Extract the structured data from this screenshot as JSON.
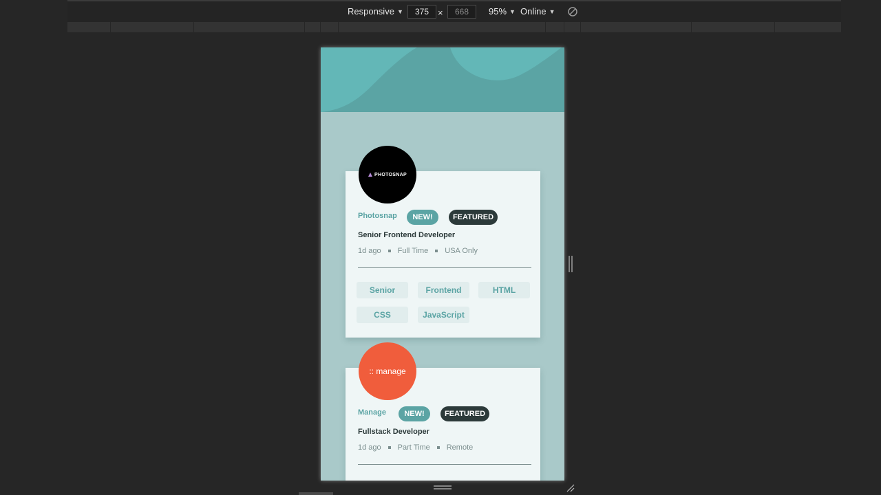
{
  "devtools": {
    "device_mode": "Responsive",
    "width_value": "375",
    "height_placeholder": "668",
    "zoom": "95%",
    "throttling": "Online",
    "times_symbol": "×"
  },
  "jobs": [
    {
      "company": "Photosnap",
      "logo_text": "PHOTOSNAP",
      "logo_color": "#000000",
      "new_label": "NEW!",
      "featured_label": "FEATURED",
      "position": "Senior Frontend Developer",
      "posted": "1d ago",
      "contract": "Full Time",
      "location": "USA Only",
      "tags": [
        "Senior",
        "Frontend",
        "HTML",
        "CSS",
        "JavaScript"
      ]
    },
    {
      "company": "Manage",
      "logo_text": ":: manage",
      "logo_color": "#f05d3c",
      "new_label": "NEW!",
      "featured_label": "FEATURED",
      "position": "Fullstack Developer",
      "posted": "1d ago",
      "contract": "Part Time",
      "location": "Remote"
    }
  ],
  "colors": {
    "primary": "#5ba4a4",
    "background": "#a9c9c9",
    "card": "#eff6f6",
    "dark": "#2c3a3a"
  }
}
